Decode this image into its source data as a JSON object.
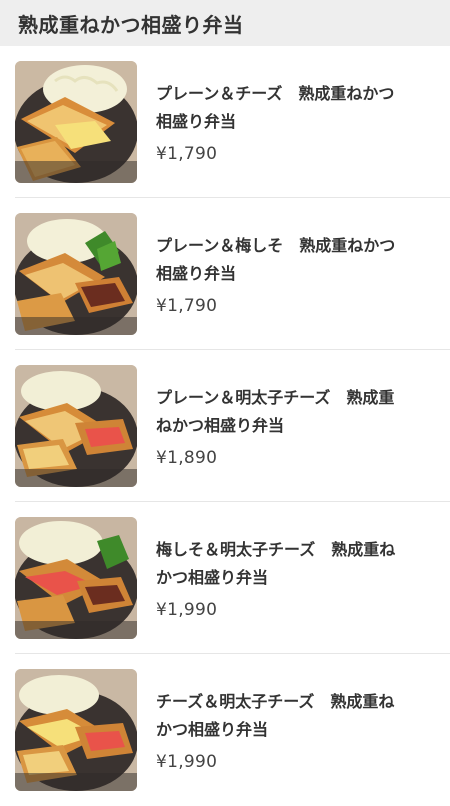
{
  "section": {
    "title": "熟成重ねかつ相盛り弁当"
  },
  "items": [
    {
      "name": "プレーン＆チーズ　熟成重ねかつ相盛り弁当",
      "price": "¥1,790",
      "image": "photo-katsu-plain-cheese"
    },
    {
      "name": "プレーン＆梅しそ　熟成重ねかつ相盛り弁当",
      "price": "¥1,790",
      "image": "photo-katsu-plain-ume-shiso"
    },
    {
      "name": "プレーン＆明太子チーズ　熟成重ねかつ相盛り弁当",
      "price": "¥1,890",
      "image": "photo-katsu-plain-mentaiko-cheese"
    },
    {
      "name": "梅しそ＆明太子チーズ　熟成重ねかつ相盛り弁当",
      "price": "¥1,990",
      "image": "photo-katsu-ume-mentaiko-cheese"
    },
    {
      "name": "チーズ＆明太子チーズ　熟成重ねかつ相盛り弁当",
      "price": "¥1,990",
      "image": "photo-katsu-cheese-mentaiko-cheese"
    }
  ],
  "colors": {
    "header_bg": "#eeeeee",
    "text": "#333333",
    "divider": "#e6e6e6"
  }
}
